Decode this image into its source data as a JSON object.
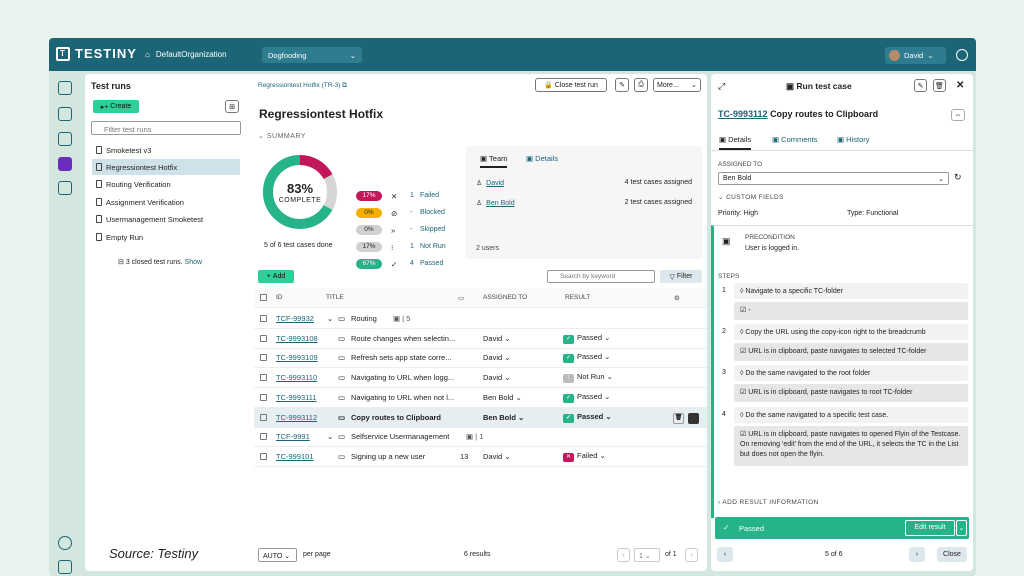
{
  "app": {
    "name": "TESTINY",
    "org": "DefaultOrganization",
    "project": "Dogfooding",
    "user": "David"
  },
  "left": {
    "title": "Test runs",
    "create": "Create",
    "filter_placeholder": "Filter test runs",
    "runs": [
      "Smoketest v3",
      "Regressiontest Hotfix",
      "Routing Verification",
      "Assignment Verification",
      "Usermanagement Smoketest",
      "Empty Run"
    ],
    "closed_text": "3 closed test runs.",
    "show": "Show"
  },
  "center": {
    "breadcrumb": "Regressiontest Hotfix",
    "breadcrumb_id": "(TR-3)",
    "close_btn": "Close test run",
    "more": "More...",
    "title": "Regressiontest Hotfix",
    "summary": "SUMMARY",
    "percent": "83%",
    "complete": "COMPLETE",
    "done": "5 of 6 test cases done",
    "stats": [
      {
        "pct": "17%",
        "icon": "✕",
        "n": "1",
        "label": "Failed",
        "bg": "#c2185b",
        "fg": "#fff"
      },
      {
        "pct": "0%",
        "icon": "⊘",
        "n": "-",
        "label": "Blocked",
        "bg": "#f4b000",
        "fg": "#222"
      },
      {
        "pct": "0%",
        "icon": "»",
        "n": "-",
        "label": "Skipped",
        "bg": "#d0d0d0",
        "fg": "#222"
      },
      {
        "pct": "17%",
        "icon": "⁝",
        "n": "1",
        "label": "Not Run",
        "bg": "#d0d0d0",
        "fg": "#222"
      },
      {
        "pct": "67%",
        "icon": "✓",
        "n": "4",
        "label": "Passed",
        "bg": "#26b38a",
        "fg": "#fff"
      }
    ],
    "team_tab": "Team",
    "details_tab": "Details",
    "team": [
      {
        "name": "David",
        "assigned": "4 test cases assigned"
      },
      {
        "name": "Ben Bold",
        "assigned": "2 test cases assigned"
      }
    ],
    "users": "2 users",
    "add": "Add",
    "search_placeholder": "Search by keyword",
    "filter": "Filter",
    "cols": {
      "id": "ID",
      "title": "TITLE",
      "assigned": "ASSIGNED TO",
      "result": "RESULT"
    },
    "rows": [
      {
        "type": "folder",
        "id": "TCF-99932",
        "title": "Routing",
        "count": "5"
      },
      {
        "type": "case",
        "id": "TC-9993108",
        "title": "Route changes when selectin...",
        "num": "",
        "assigned": "David",
        "result": "Passed",
        "rc": "#26b38a",
        "ri": "✓"
      },
      {
        "type": "case",
        "id": "TC-9993109",
        "title": "Refresh sets app state corre...",
        "num": "",
        "assigned": "David",
        "result": "Passed",
        "rc": "#26b38a",
        "ri": "✓"
      },
      {
        "type": "case",
        "id": "TC-9993110",
        "title": "Navigating to URL when logg...",
        "num": "",
        "assigned": "David",
        "result": "Not Run",
        "rc": "#bbbbbb",
        "ri": "⁝"
      },
      {
        "type": "case",
        "id": "TC-9993111",
        "title": "Navigating to URL when not l...",
        "num": "",
        "assigned": "Ben Bold",
        "result": "Passed",
        "rc": "#26b38a",
        "ri": "✓"
      },
      {
        "type": "case",
        "id": "TC-9993112",
        "title": "Copy routes to Clipboard",
        "num": "",
        "assigned": "Ben Bold",
        "result": "Passed",
        "rc": "#26b38a",
        "ri": "✓"
      },
      {
        "type": "folder",
        "id": "TCF-9991",
        "title": "Selfservice Usermanagement",
        "count": "1"
      },
      {
        "type": "case",
        "id": "TC-999101",
        "title": "Signing up a new user",
        "num": "13",
        "assigned": "David",
        "result": "Failed",
        "rc": "#c2185b",
        "ri": "✕"
      }
    ],
    "footer": {
      "auto": "AUTO",
      "per_page": "per page",
      "results": "6 results",
      "page": "1",
      "of": "of 1"
    }
  },
  "right": {
    "header": "Run test case",
    "tc_id": "TC-9993112",
    "tc_title": "Copy routes to Clipboard",
    "tabs": [
      "Details",
      "Comments",
      "History"
    ],
    "assigned_label": "ASSIGNED TO",
    "assigned": "Ben Bold",
    "custom": "CUSTOM FIELDS",
    "priority": "Priority: High",
    "type": "Type: Functional",
    "pre_label": "PRECONDITION",
    "pre": "User is logged in.",
    "steps_label": "STEPS",
    "steps": [
      {
        "n": "1",
        "s": "Navigate to a specific TC-folder",
        "e": "-"
      },
      {
        "n": "2",
        "s": "Copy the URL using the copy-icon right to the breadcrumb",
        "e": "URL is in clipboard, paste navigates to selected TC-folder"
      },
      {
        "n": "3",
        "s": "Do the same navigated to the root folder",
        "e": "URL is in clipboard, paste navigates to root TC-folder"
      },
      {
        "n": "4",
        "s": "Do the same navigated to a specific test case.",
        "e": "URL is in clipboard, paste navigates to opened Flyin of the Testcase. On removing 'edit' from the end of the URL, it selects the TC in the List but does not open the flyin."
      }
    ],
    "add_result": "ADD RESULT INFORMATION",
    "passed": "Passed",
    "edit": "Edit result",
    "pager": "5 of 6",
    "close": "Close"
  },
  "source": "Source: Testiny"
}
